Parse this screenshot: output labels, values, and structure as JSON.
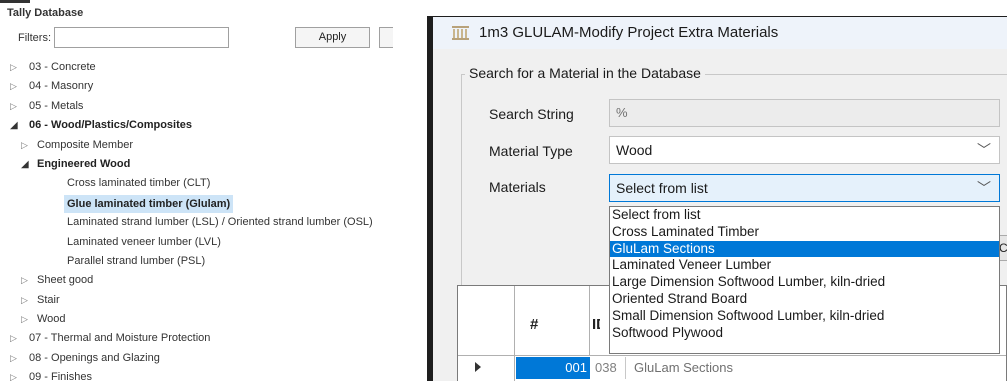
{
  "tally": {
    "title": "Tally Database",
    "filters_label": "Filters:",
    "filters_value": "",
    "apply_label": "Apply",
    "tree": [
      {
        "level": 0,
        "arrow": "▷",
        "label": "03 - Concrete",
        "bold": false,
        "selected": false
      },
      {
        "level": 0,
        "arrow": "▷",
        "label": "04 - Masonry",
        "bold": false,
        "selected": false
      },
      {
        "level": 0,
        "arrow": "▷",
        "label": "05 - Metals",
        "bold": false,
        "selected": false
      },
      {
        "level": 0,
        "arrow": "◢",
        "label": "06 - Wood/Plastics/Composites",
        "bold": true,
        "selected": false
      },
      {
        "level": 1,
        "arrow": "▷",
        "label": "Composite Member",
        "bold": false,
        "selected": false
      },
      {
        "level": 1,
        "arrow": "◢",
        "label": "Engineered Wood",
        "bold": true,
        "selected": false
      },
      {
        "level": 2,
        "arrow": "",
        "label": "Cross laminated timber (CLT)",
        "bold": false,
        "selected": false
      },
      {
        "level": 2,
        "arrow": "",
        "label": "Glue laminated timber (Glulam)",
        "bold": true,
        "selected": true
      },
      {
        "level": 2,
        "arrow": "",
        "label": "Laminated strand lumber (LSL) / Oriented strand lumber (OSL)",
        "bold": false,
        "selected": false
      },
      {
        "level": 2,
        "arrow": "",
        "label": "Laminated veneer lumber (LVL)",
        "bold": false,
        "selected": false
      },
      {
        "level": 2,
        "arrow": "",
        "label": "Parallel strand lumber (PSL)",
        "bold": false,
        "selected": false
      },
      {
        "level": 1,
        "arrow": "▷",
        "label": "Sheet good",
        "bold": false,
        "selected": false
      },
      {
        "level": 1,
        "arrow": "▷",
        "label": "Stair",
        "bold": false,
        "selected": false
      },
      {
        "level": 1,
        "arrow": "▷",
        "label": "Wood",
        "bold": false,
        "selected": false
      },
      {
        "level": 0,
        "arrow": "▷",
        "label": "07 - Thermal and Moisture Protection",
        "bold": false,
        "selected": false
      },
      {
        "level": 0,
        "arrow": "▷",
        "label": "08 - Openings and Glazing",
        "bold": false,
        "selected": false
      },
      {
        "level": 0,
        "arrow": "▷",
        "label": "09 - Finishes",
        "bold": false,
        "selected": false
      }
    ]
  },
  "dialog": {
    "title": "1m3 GLULAM-Modify Project Extra Materials",
    "group_title": "Search for a Material in the Database",
    "search_label": "Search String",
    "search_value": "%",
    "type_label": "Material Type",
    "type_value": "Wood",
    "materials_label": "Materials",
    "materials_value": "Select from list",
    "dropdown_options": [
      "Select from list",
      "Cross Laminated Timber",
      "GluLam Sections",
      "Laminated Veneer Lumber",
      "Large Dimension Softwood Lumber, kiln-dried",
      "Oriented Strand Board",
      "Small Dimension Softwood Lumber, kiln-dried",
      "Softwood Plywood"
    ],
    "dropdown_highlighted_index": 2,
    "side_button_text": "Cle",
    "grid": {
      "col_hash": "#",
      "col_id": "ID",
      "rows": [
        {
          "num": "001",
          "id": "038",
          "material": "GluLam Sections"
        }
      ]
    }
  },
  "colors": {
    "accent": "#0078d7",
    "selection_bg": "#cde4f7",
    "dialog_bg": "#f0f0f0"
  }
}
